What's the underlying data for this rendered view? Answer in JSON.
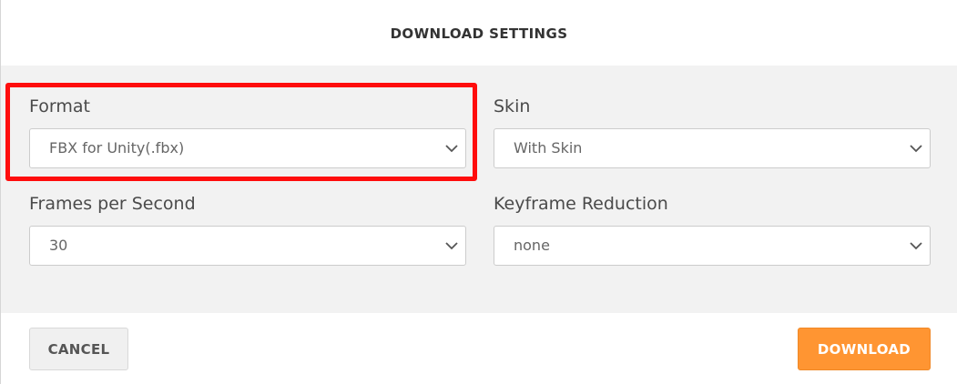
{
  "dialog": {
    "title": "DOWNLOAD SETTINGS"
  },
  "fields": {
    "format": {
      "label": "Format",
      "value": "FBX for Unity(.fbx)"
    },
    "skin": {
      "label": "Skin",
      "value": "With Skin"
    },
    "fps": {
      "label": "Frames per Second",
      "value": "30"
    },
    "keyframe": {
      "label": "Keyframe Reduction",
      "value": "none"
    }
  },
  "footer": {
    "cancel_label": "CANCEL",
    "download_label": "DOWNLOAD"
  },
  "colors": {
    "accent": "#ff9532",
    "highlight": "#ff0d0d",
    "panel_bg": "#f2f2f2"
  },
  "icons": {
    "dropdown": "chevron-down-icon"
  }
}
